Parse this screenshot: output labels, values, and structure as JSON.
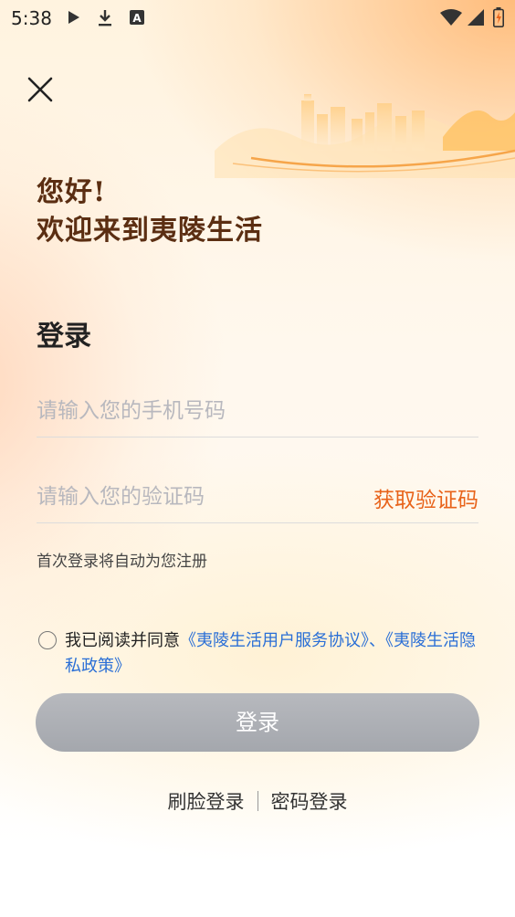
{
  "status_bar": {
    "time": "5:38",
    "left_icons": [
      "play-store-icon",
      "download-icon",
      "a-box-icon"
    ],
    "right_icons": [
      "wifi-icon",
      "signal-icon",
      "battery-charging-icon"
    ]
  },
  "header": {
    "close_icon": "close-icon",
    "greeting_line1": "您好!",
    "greeting_line2": "欢迎来到夷陵生活"
  },
  "form": {
    "title": "登录",
    "phone_placeholder": "请输入您的手机号码",
    "phone_value": "",
    "code_placeholder": "请输入您的验证码",
    "code_value": "",
    "get_code_label": "获取验证码",
    "hint": "首次登录将自动为您注册",
    "agreement_prefix": "我已阅读并同意",
    "agreement_link1": "《夷陵生活用户服务协议》",
    "agreement_sep": "、",
    "agreement_link2": "《夷陵生活隐私政策》",
    "agreement_checked": false,
    "login_label": "登录"
  },
  "alt_login": {
    "face_label": "刷脸登录",
    "password_label": "密码登录"
  },
  "colors": {
    "accent_orange": "#e8631a",
    "link_blue": "#2a6fd6",
    "greeting_brown": "#5b2e12",
    "button_gray": "#a8abb1"
  }
}
